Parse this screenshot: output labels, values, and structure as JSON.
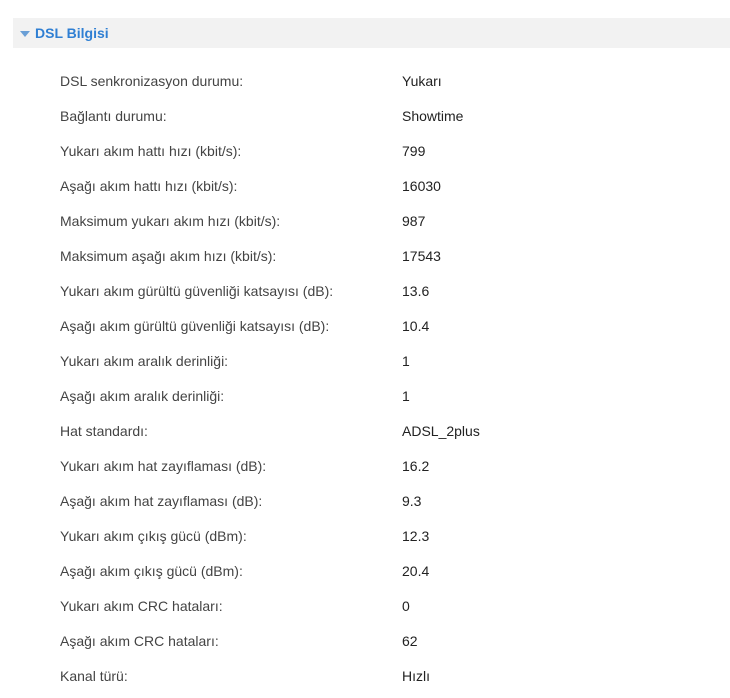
{
  "section": {
    "title": "DSL Bilgisi",
    "expanded": true,
    "toggle_icon": "triangle-down-icon",
    "accent_color": "#2f7fd3"
  },
  "rows": [
    {
      "label": "DSL senkronizasyon durumu:",
      "value": "Yukarı"
    },
    {
      "label": "Bağlantı durumu:",
      "value": "Showtime"
    },
    {
      "label": "Yukarı akım hattı hızı (kbit/s):",
      "value": "799"
    },
    {
      "label": "Aşağı akım hattı hızı (kbit/s):",
      "value": "16030"
    },
    {
      "label": "Maksimum yukarı akım hızı (kbit/s):",
      "value": "987"
    },
    {
      "label": "Maksimum aşağı akım hızı (kbit/s):",
      "value": "17543"
    },
    {
      "label": "Yukarı akım gürültü güvenliği katsayısı (dB):",
      "value": "13.6"
    },
    {
      "label": "Aşağı akım gürültü güvenliği katsayısı (dB):",
      "value": "10.4"
    },
    {
      "label": "Yukarı akım aralık derinliği:",
      "value": "1"
    },
    {
      "label": "Aşağı akım aralık derinliği:",
      "value": "1"
    },
    {
      "label": "Hat standardı:",
      "value": "ADSL_2plus"
    },
    {
      "label": "Yukarı akım hat zayıflaması (dB):",
      "value": "16.2"
    },
    {
      "label": "Aşağı akım hat zayıflaması (dB):",
      "value": "9.3"
    },
    {
      "label": "Yukarı akım çıkış gücü (dBm):",
      "value": "12.3"
    },
    {
      "label": "Aşağı akım çıkış gücü (dBm):",
      "value": "20.4"
    },
    {
      "label": "Yukarı akım CRC hataları:",
      "value": "0"
    },
    {
      "label": "Aşağı akım CRC hataları:",
      "value": "62"
    },
    {
      "label": "Kanal türü:",
      "value": "Hızlı"
    }
  ]
}
